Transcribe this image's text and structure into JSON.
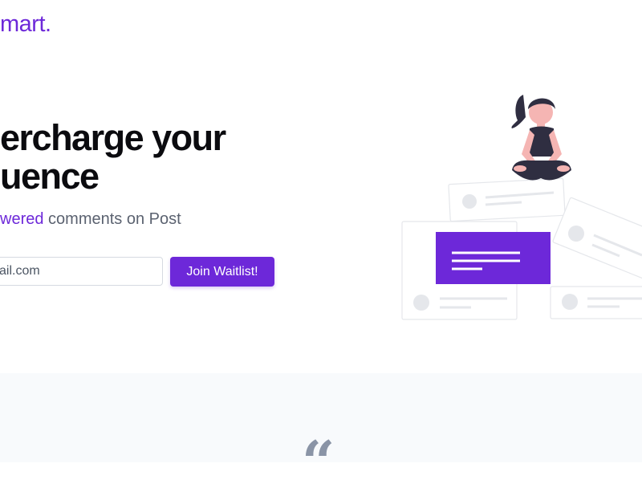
{
  "header": {
    "logo_text": "mart."
  },
  "hero": {
    "headline_line1": "ercharge your",
    "headline_line2": "uence",
    "subhead_accent": "wered",
    "subhead_rest": " comments on Post",
    "email_placeholder": "ail.com",
    "join_button_label": "Join Waitlist!"
  },
  "testimonial": {
    "quote_glyph": "“"
  },
  "colors": {
    "accent": "#6d28d9",
    "headline": "#0b0b0f",
    "subtext": "#5b6270",
    "section_bg": "#f8fafc"
  },
  "icons": {
    "illustration": "meditating-person-illustration"
  }
}
